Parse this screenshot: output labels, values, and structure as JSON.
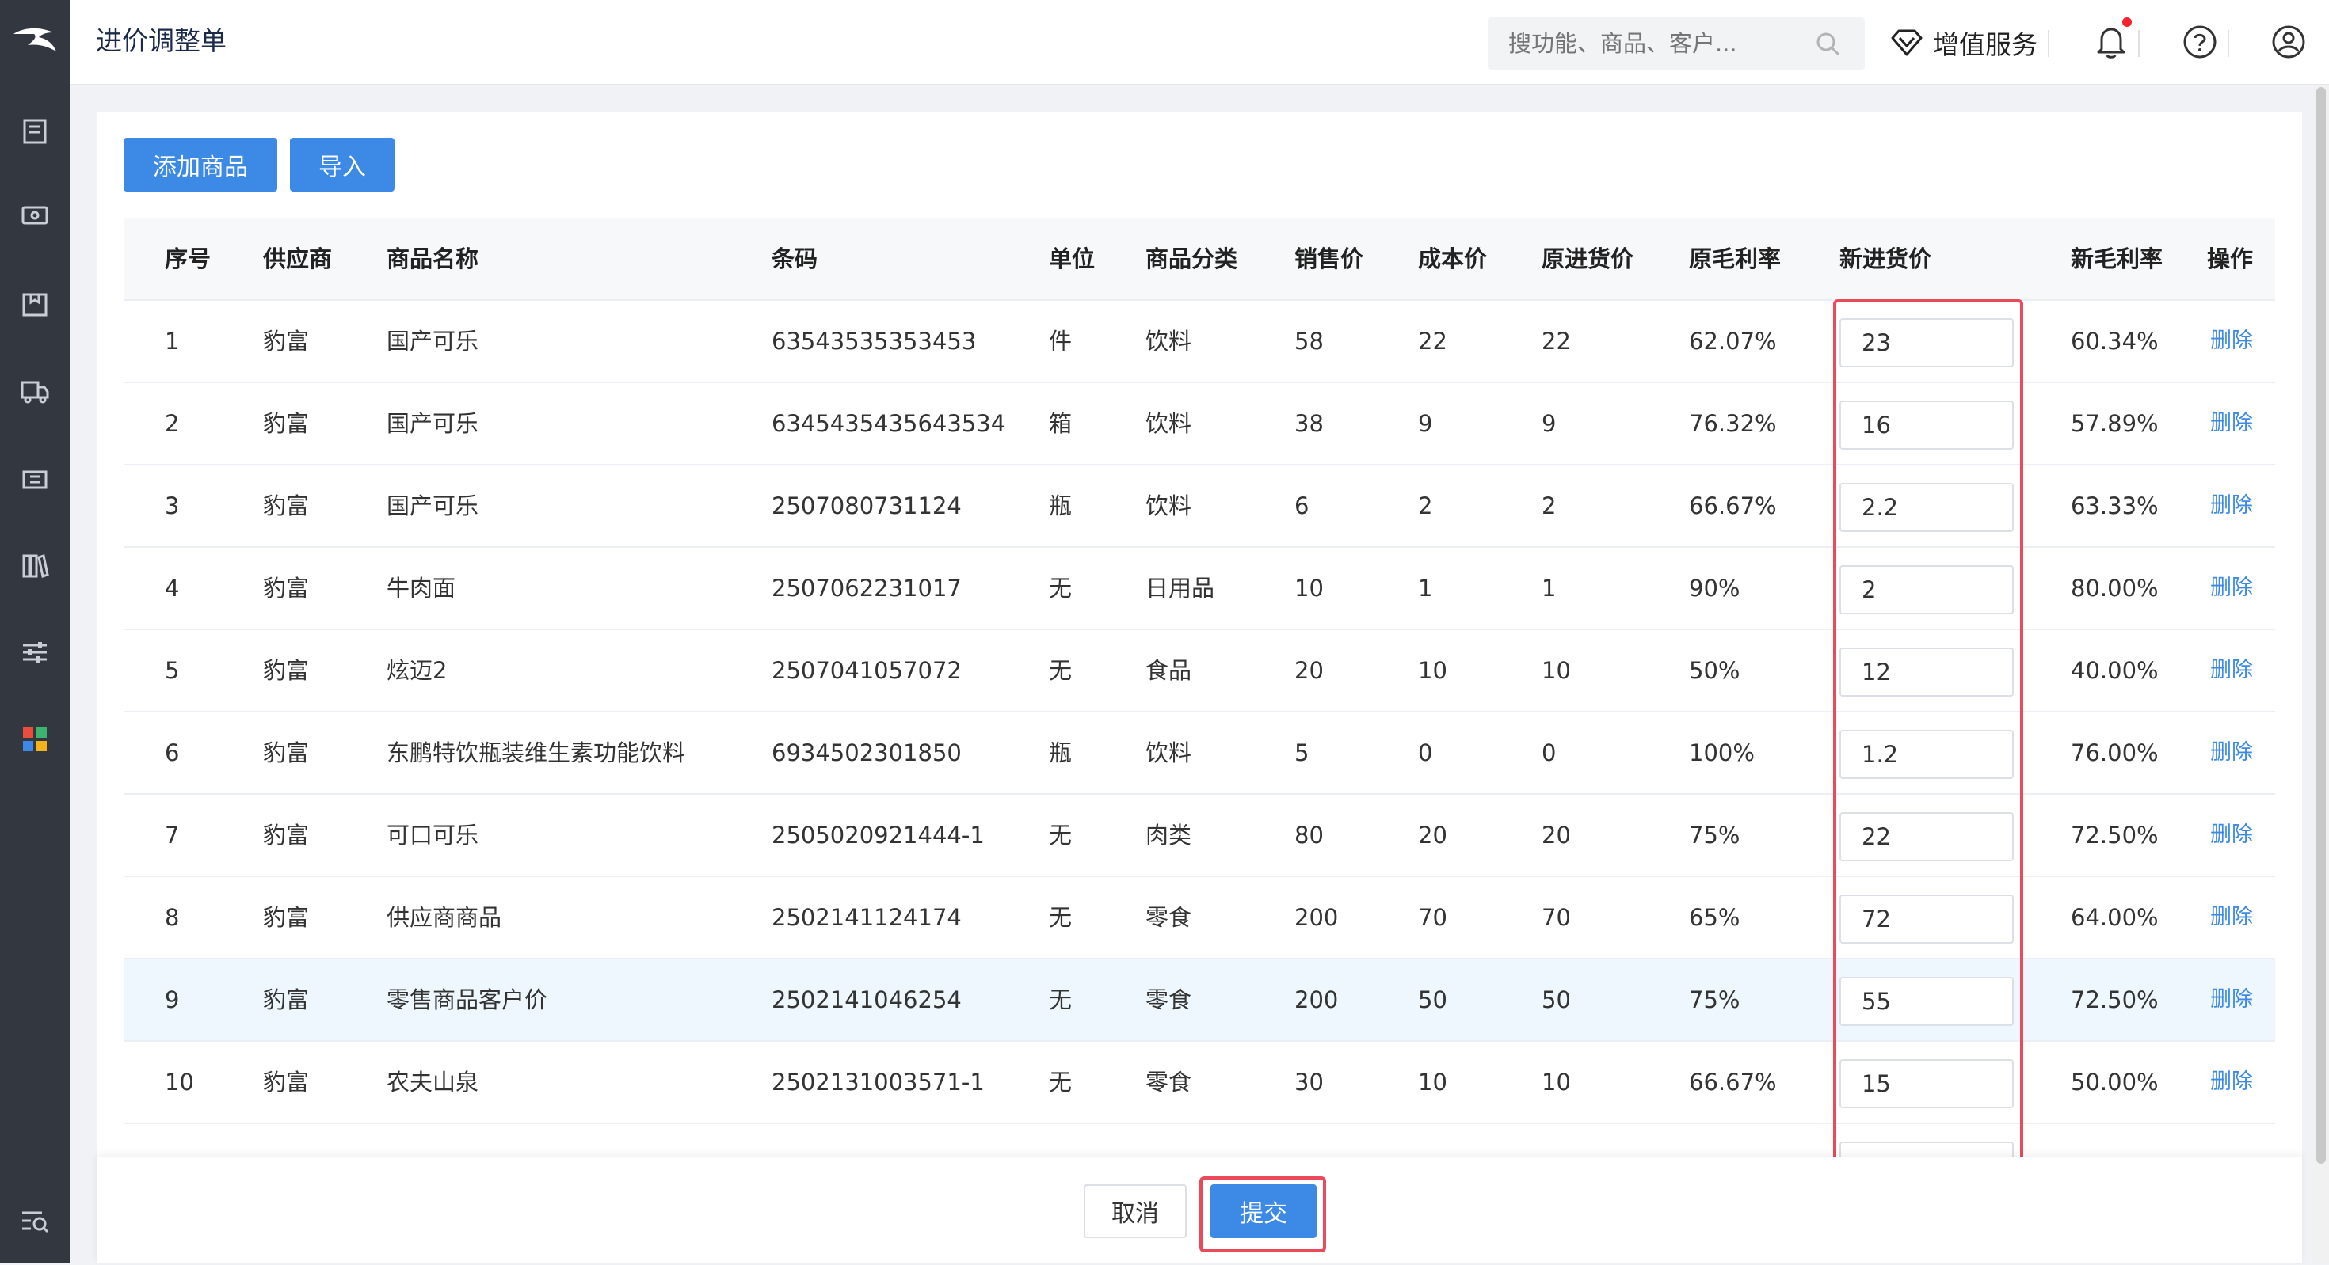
{
  "header": {
    "title": "进价调整单",
    "search_placeholder": "搜功能、商品、客户...",
    "vip_label": "增值服务"
  },
  "toolbar": {
    "add_label": "添加商品",
    "import_label": "导入"
  },
  "table": {
    "columns": [
      "序号",
      "供应商",
      "商品名称",
      "条码",
      "单位",
      "商品分类",
      "销售价",
      "成本价",
      "原进货价",
      "原毛利率",
      "新进货价",
      "新毛利率",
      "操作"
    ],
    "rows": [
      {
        "idx": "1",
        "supplier": "豹富",
        "name": "国产可乐",
        "barcode": "63543535353453",
        "unit": "件",
        "category": "饮料",
        "sale": "58",
        "cost": "22",
        "old_price": "22",
        "old_margin": "62.07%",
        "new_price": "23",
        "new_margin": "60.34%",
        "action": "删除"
      },
      {
        "idx": "2",
        "supplier": "豹富",
        "name": "国产可乐",
        "barcode": "6345435435643534",
        "unit": "箱",
        "category": "饮料",
        "sale": "38",
        "cost": "9",
        "old_price": "9",
        "old_margin": "76.32%",
        "new_price": "16",
        "new_margin": "57.89%",
        "action": "删除"
      },
      {
        "idx": "3",
        "supplier": "豹富",
        "name": "国产可乐",
        "barcode": "2507080731124",
        "unit": "瓶",
        "category": "饮料",
        "sale": "6",
        "cost": "2",
        "old_price": "2",
        "old_margin": "66.67%",
        "new_price": "2.2",
        "new_margin": "63.33%",
        "action": "删除"
      },
      {
        "idx": "4",
        "supplier": "豹富",
        "name": "牛肉面",
        "barcode": "2507062231017",
        "unit": "无",
        "category": "日用品",
        "sale": "10",
        "cost": "1",
        "old_price": "1",
        "old_margin": "90%",
        "new_price": "2",
        "new_margin": "80.00%",
        "action": "删除"
      },
      {
        "idx": "5",
        "supplier": "豹富",
        "name": "炫迈2",
        "barcode": "2507041057072",
        "unit": "无",
        "category": "食品",
        "sale": "20",
        "cost": "10",
        "old_price": "10",
        "old_margin": "50%",
        "new_price": "12",
        "new_margin": "40.00%",
        "action": "删除"
      },
      {
        "idx": "6",
        "supplier": "豹富",
        "name": "东鹏特饮瓶装维生素功能饮料",
        "barcode": "6934502301850",
        "unit": "瓶",
        "category": "饮料",
        "sale": "5",
        "cost": "0",
        "old_price": "0",
        "old_margin": "100%",
        "new_price": "1.2",
        "new_margin": "76.00%",
        "action": "删除"
      },
      {
        "idx": "7",
        "supplier": "豹富",
        "name": "可口可乐",
        "barcode": "2505020921444-1",
        "unit": "无",
        "category": "肉类",
        "sale": "80",
        "cost": "20",
        "old_price": "20",
        "old_margin": "75%",
        "new_price": "22",
        "new_margin": "72.50%",
        "action": "删除"
      },
      {
        "idx": "8",
        "supplier": "豹富",
        "name": "供应商商品",
        "barcode": "2502141124174",
        "unit": "无",
        "category": "零食",
        "sale": "200",
        "cost": "70",
        "old_price": "70",
        "old_margin": "65%",
        "new_price": "72",
        "new_margin": "64.00%",
        "action": "删除"
      },
      {
        "idx": "9",
        "supplier": "豹富",
        "name": "零售商品客户价",
        "barcode": "2502141046254",
        "unit": "无",
        "category": "零食",
        "sale": "200",
        "cost": "50",
        "old_price": "50",
        "old_margin": "75%",
        "new_price": "55",
        "new_margin": "72.50%",
        "action": "删除"
      },
      {
        "idx": "10",
        "supplier": "豹富",
        "name": "农夫山泉",
        "barcode": "2502131003571-1",
        "unit": "无",
        "category": "零食",
        "sale": "30",
        "cost": "10",
        "old_price": "10",
        "old_margin": "66.67%",
        "new_price": "15",
        "new_margin": "50.00%",
        "action": "删除"
      }
    ]
  },
  "footer": {
    "cancel_label": "取消",
    "submit_label": "提交"
  },
  "colors": {
    "primary": "#3c8ae6",
    "sidebar": "#333840",
    "highlight_row": "#eef7fd",
    "annotation": "#ea4a5a"
  },
  "icons": {
    "sidebar": [
      "logo-icon",
      "document-icon",
      "cash-icon",
      "box-icon",
      "truck-icon",
      "ticket-icon",
      "books-icon",
      "sliders-icon",
      "apps-icon",
      "search-list-icon"
    ]
  }
}
